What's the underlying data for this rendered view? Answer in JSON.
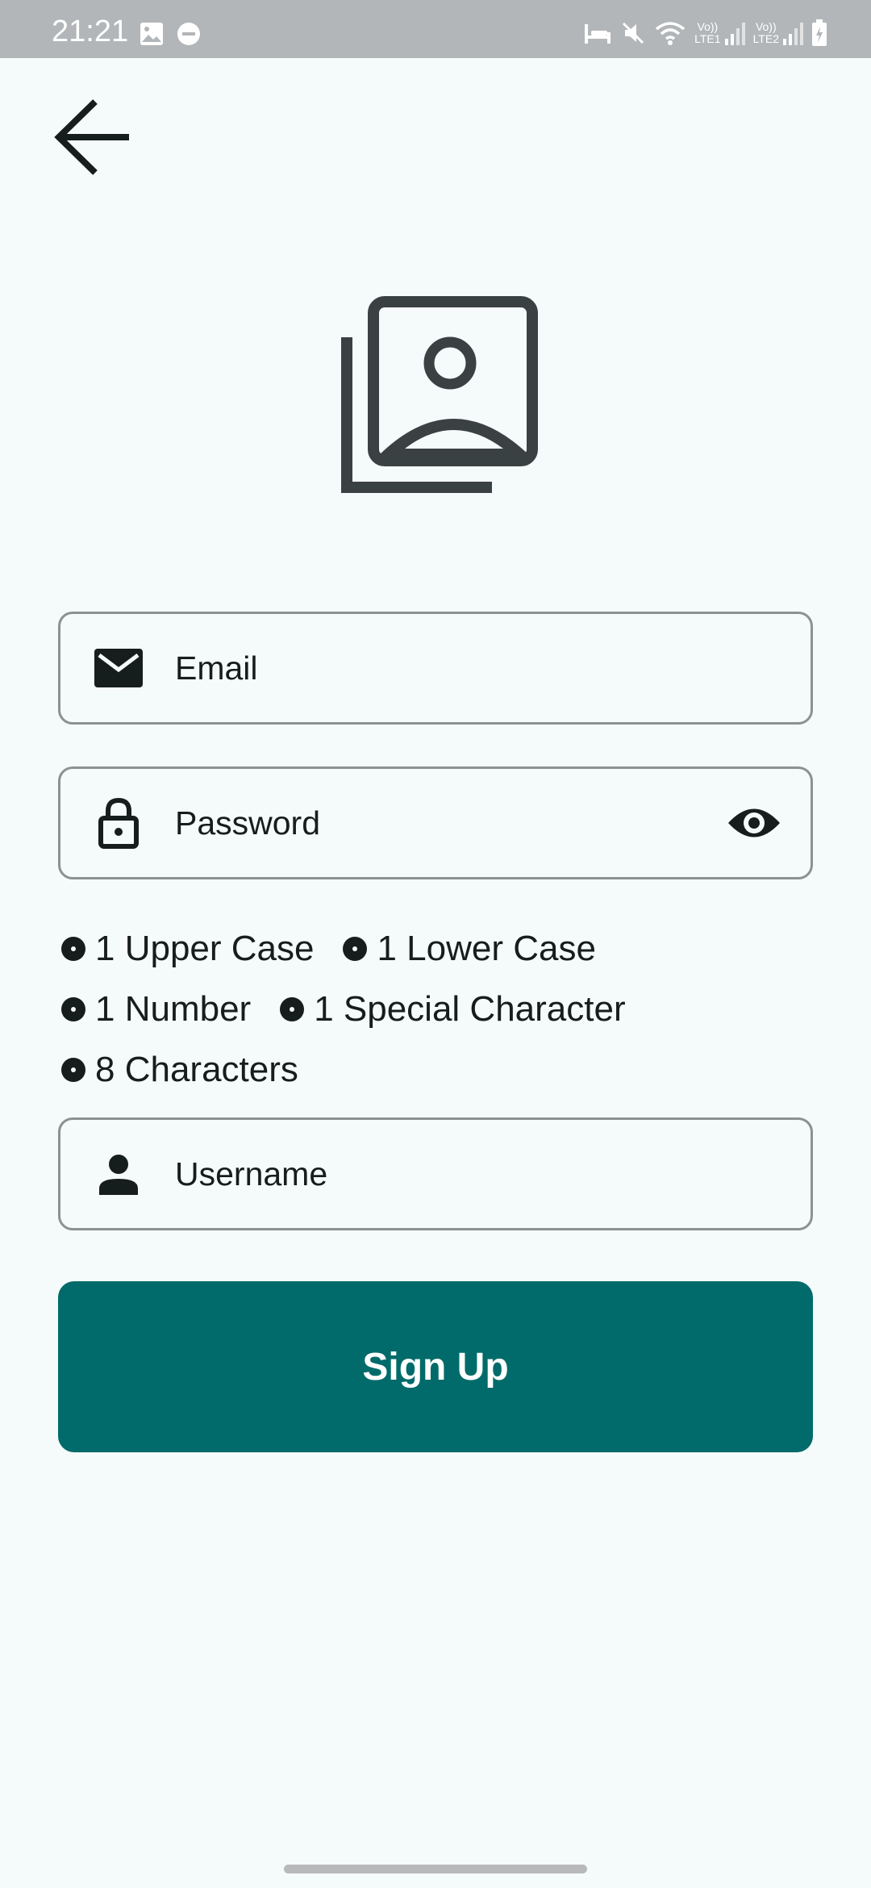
{
  "status_bar": {
    "time": "21:21",
    "left_icons": [
      "image-icon",
      "do-not-disturb-icon"
    ],
    "right_icons": [
      "bed-icon",
      "mute-icon",
      "wifi-icon",
      "signal-lte1-icon",
      "signal-lte2-icon",
      "battery-icon"
    ],
    "lte1_label": "LTE1",
    "lte2_label": "LTE2",
    "volte_label": "Vo))"
  },
  "form": {
    "email_placeholder": "Email",
    "password_placeholder": "Password",
    "username_placeholder": "Username",
    "signup_label": "Sign Up"
  },
  "password_rules": {
    "rows": [
      [
        "1 Upper Case",
        "1 Lower Case"
      ],
      [
        "1 Number",
        "1 Special Character"
      ],
      [
        "8 Characters"
      ]
    ]
  },
  "colors": {
    "primary": "#006b6a",
    "background": "#f5fafb",
    "status_bar": "#b3b6b8",
    "outline": "#8a9292",
    "on_surface": "#161d1d"
  }
}
